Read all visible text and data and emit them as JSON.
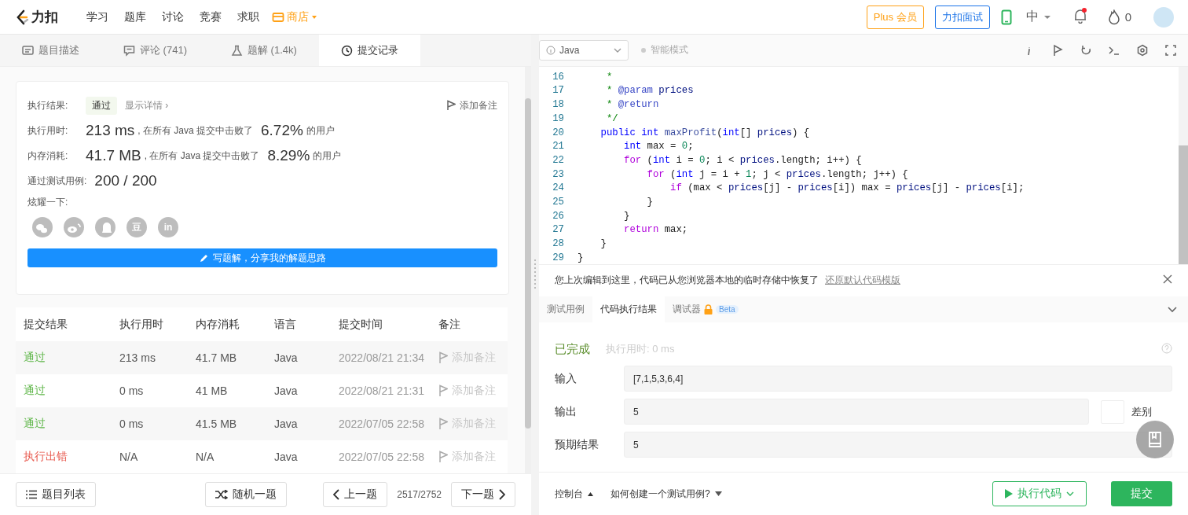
{
  "header": {
    "logo": "力扣",
    "nav": [
      {
        "label": "学习",
        "selected": false
      },
      {
        "label": "题库",
        "selected": false
      },
      {
        "label": "讨论",
        "selected": false
      },
      {
        "label": "竞赛",
        "selected": false
      },
      {
        "label": "求职",
        "selected": false
      }
    ],
    "store": "商店",
    "plus": "Plus 会员",
    "interview": "力扣面试",
    "language": "中",
    "has_unread": true,
    "points": "0"
  },
  "left_tabs": [
    {
      "label": "题目描述",
      "kind": "description",
      "selected": false
    },
    {
      "label": "评论 (741)",
      "kind": "comment",
      "selected": false
    },
    {
      "label": "题解 (1.4k)",
      "kind": "solution",
      "selected": false
    },
    {
      "label": "提交记录",
      "kind": "history",
      "selected": true
    }
  ],
  "result_card": {
    "status_label": "执行结果:",
    "status": "通过",
    "details": "显示详情 ›",
    "add_note": "添加备注",
    "stats": [
      {
        "label": "执行用时:",
        "value": "213 ms",
        "text": ", 在所有 Java 提交中击败了",
        "percent": "6.72%",
        "suffix": "的用户"
      },
      {
        "label": "内存消耗:",
        "value": "41.7 MB",
        "text": ", 在所有 Java 提交中击败了",
        "percent": "8.29%",
        "suffix": "的用户"
      }
    ],
    "tests_label": "通过测试用例:",
    "tests": "200 / 200",
    "share_label": "炫耀一下:",
    "share": [
      {
        "kind": "wechat"
      },
      {
        "kind": "weibo"
      },
      {
        "kind": "qq"
      },
      {
        "kind": "douban",
        "glyph": "豆"
      },
      {
        "kind": "linkedin",
        "glyph": "in"
      }
    ],
    "write_button": "写题解，分享我的解题思路"
  },
  "submissions": {
    "columns": [
      "提交结果",
      "执行用时",
      "内存消耗",
      "语言",
      "提交时间",
      "备注"
    ],
    "rows": [
      {
        "status": "通过",
        "kind": "accepted",
        "time": "213 ms",
        "memory": "41.7 MB",
        "language": "Java",
        "submitted": "2022/08/21 21:34",
        "note": "添加备注"
      },
      {
        "status": "通过",
        "kind": "accepted",
        "time": "0 ms",
        "memory": "41 MB",
        "language": "Java",
        "submitted": "2022/08/21 21:31",
        "note": "添加备注"
      },
      {
        "status": "通过",
        "kind": "accepted",
        "time": "0 ms",
        "memory": "41.5 MB",
        "language": "Java",
        "submitted": "2022/07/05 22:58",
        "note": "添加备注"
      },
      {
        "status": "执行出错",
        "kind": "error",
        "time": "N/A",
        "memory": "N/A",
        "language": "Java",
        "submitted": "2022/07/05 22:58",
        "note": "添加备注"
      }
    ]
  },
  "left_footer": {
    "list": "题目列表",
    "random": "随机一题",
    "prev": "上一题",
    "counter": "2517/2752",
    "next": "下一题"
  },
  "editor_toolbar": {
    "language": "Java",
    "smart_mode": {
      "label": "智能模式",
      "on": false
    }
  },
  "code": [
    {
      "n": "16",
      "tokens": [
        {
          "kind": "comment",
          "text": "     *"
        }
      ]
    },
    {
      "n": "17",
      "tokens": [
        {
          "kind": "comment",
          "text": "     * "
        },
        {
          "kind": "doctag",
          "text": "@param"
        },
        {
          "kind": "variable",
          "text": " prices"
        }
      ]
    },
    {
      "n": "18",
      "tokens": [
        {
          "kind": "comment",
          "text": "     * "
        },
        {
          "kind": "doctag",
          "text": "@return"
        }
      ]
    },
    {
      "n": "19",
      "tokens": [
        {
          "kind": "comment",
          "text": "     */"
        }
      ]
    },
    {
      "n": "20",
      "tokens": [
        {
          "kind": "type",
          "text": "    public"
        },
        {
          "kind": "type",
          "text": " int"
        },
        {
          "kind": "function",
          "text": " maxProfit"
        },
        {
          "kind": "plain",
          "text": "("
        },
        {
          "kind": "type",
          "text": "int"
        },
        {
          "kind": "plain",
          "text": "[] "
        },
        {
          "kind": "variable",
          "text": "prices"
        },
        {
          "kind": "plain",
          "text": ") {"
        }
      ]
    },
    {
      "n": "21",
      "tokens": [
        {
          "kind": "type",
          "text": "        int"
        },
        {
          "kind": "plain",
          "text": " max = "
        },
        {
          "kind": "number",
          "text": "0"
        },
        {
          "kind": "plain",
          "text": ";"
        }
      ]
    },
    {
      "n": "22",
      "tokens": [
        {
          "kind": "keyword",
          "text": "        for"
        },
        {
          "kind": "plain",
          "text": " ("
        },
        {
          "kind": "type",
          "text": "int"
        },
        {
          "kind": "plain",
          "text": " i = "
        },
        {
          "kind": "number",
          "text": "0"
        },
        {
          "kind": "plain",
          "text": "; i < "
        },
        {
          "kind": "variable",
          "text": "prices"
        },
        {
          "kind": "plain",
          "text": ".length; i++) {"
        }
      ]
    },
    {
      "n": "23",
      "tokens": [
        {
          "kind": "keyword",
          "text": "            for"
        },
        {
          "kind": "plain",
          "text": " ("
        },
        {
          "kind": "type",
          "text": "int"
        },
        {
          "kind": "plain",
          "text": " j = i + "
        },
        {
          "kind": "number",
          "text": "1"
        },
        {
          "kind": "plain",
          "text": "; j < "
        },
        {
          "kind": "variable",
          "text": "prices"
        },
        {
          "kind": "plain",
          "text": ".length; j++) {"
        }
      ]
    },
    {
      "n": "24",
      "tokens": [
        {
          "kind": "keyword",
          "text": "                if"
        },
        {
          "kind": "plain",
          "text": " (max < "
        },
        {
          "kind": "variable",
          "text": "prices"
        },
        {
          "kind": "plain",
          "text": "[j] - "
        },
        {
          "kind": "variable",
          "text": "prices"
        },
        {
          "kind": "plain",
          "text": "[i]) max = "
        },
        {
          "kind": "variable",
          "text": "prices"
        },
        {
          "kind": "plain",
          "text": "[j] - "
        },
        {
          "kind": "variable",
          "text": "prices"
        },
        {
          "kind": "plain",
          "text": "[i];"
        }
      ]
    },
    {
      "n": "25",
      "tokens": [
        {
          "kind": "plain",
          "text": "            }"
        }
      ]
    },
    {
      "n": "26",
      "tokens": [
        {
          "kind": "plain",
          "text": "        }"
        }
      ]
    },
    {
      "n": "27",
      "tokens": [
        {
          "kind": "keyword",
          "text": "        return"
        },
        {
          "kind": "plain",
          "text": " max;"
        }
      ]
    },
    {
      "n": "28",
      "tokens": [
        {
          "kind": "plain",
          "text": "    }"
        }
      ]
    },
    {
      "n": "29",
      "tokens": [
        {
          "kind": "plain",
          "text": "}"
        }
      ]
    }
  ],
  "restore_notice": {
    "text": "您上次编辑到这里，代码已从您浏览器本地的临时存储中恢复了",
    "link": "还原默认代码模版"
  },
  "console_tabs": [
    {
      "label": "测试用例",
      "selected": false,
      "locked": false
    },
    {
      "label": "代码执行结果",
      "selected": true,
      "locked": false
    },
    {
      "label": "调试器",
      "selected": false,
      "locked": true,
      "badge": "Beta"
    }
  ],
  "run_result": {
    "status": "已完成",
    "runtime": "执行用时: 0 ms",
    "fields": [
      {
        "label": "输入",
        "value": "[7,1,5,3,6,4]"
      },
      {
        "label": "输出",
        "value": "5",
        "diff": {
          "label": "差别",
          "on": false
        }
      },
      {
        "label": "预期结果",
        "value": "5"
      }
    ]
  },
  "right_footer": {
    "console": "控制台",
    "howto": "如何创建一个测试用例?",
    "run": "执行代码",
    "submit": "提交"
  }
}
